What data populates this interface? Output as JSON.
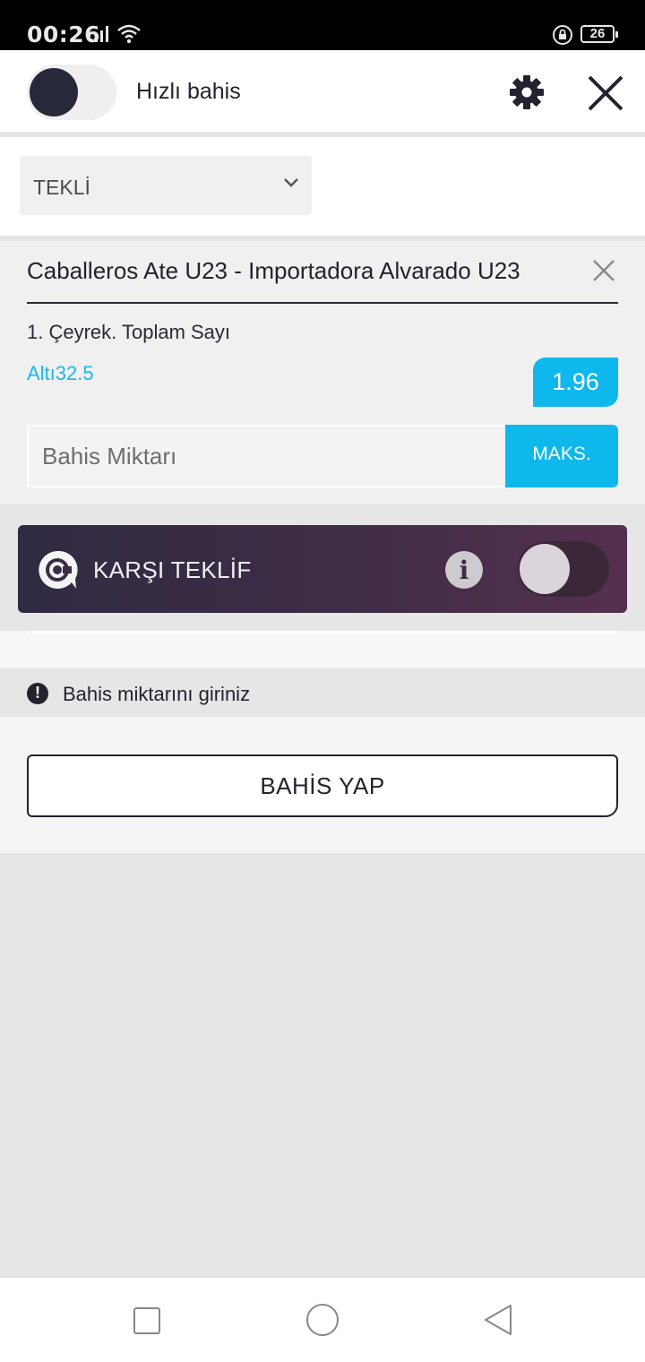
{
  "status_bar": {
    "time": "00:26",
    "battery": "26",
    "icons": [
      "signal-icon",
      "wifi-icon",
      "rotation-lock-icon",
      "battery-icon"
    ]
  },
  "header": {
    "quick_bet_label": "Hızlı bahis",
    "quick_bet_enabled": false,
    "icons": [
      "gear-icon",
      "close-icon"
    ]
  },
  "bet_type": {
    "selected": "TEKLİ"
  },
  "selection": {
    "match": "Caballeros Ate U23 - Importadora Alvarado U23",
    "market": "1. Çeyrek. Toplam Sayı",
    "outcome": "Altı32.5",
    "odds": "1.96",
    "stake_placeholder": "Bahis Miktarı",
    "max_label": "MAKS."
  },
  "counter_offer": {
    "label": "KARŞI TEKLİF",
    "info": "i",
    "enabled": false
  },
  "warning": {
    "icon_glyph": "!",
    "text": "Bahis miktarını giriniz"
  },
  "place_bet": {
    "label": "BAHİS YAP"
  },
  "colors": {
    "accent": "#0fb8ec",
    "dark": "#23232f",
    "counter_gradient_start": "#302b42",
    "counter_gradient_end": "#55304e"
  }
}
